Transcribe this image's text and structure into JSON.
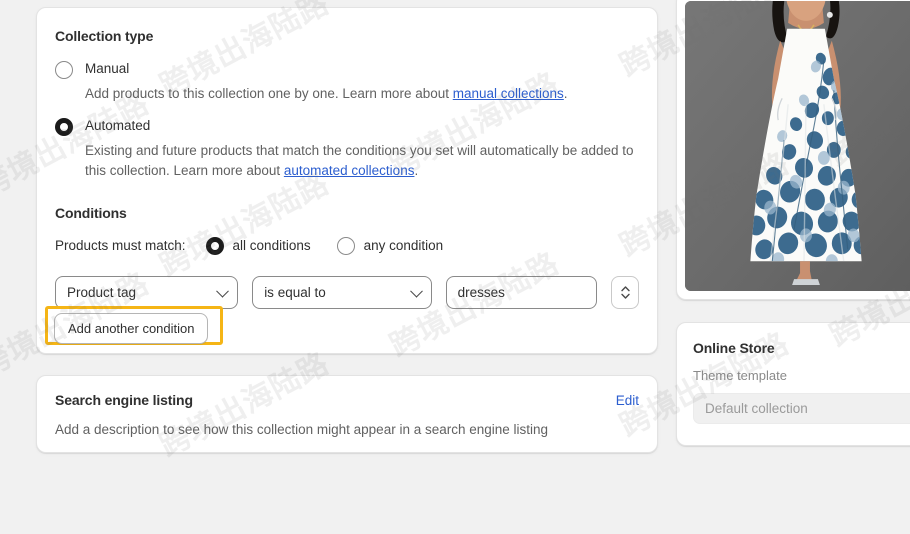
{
  "collection_type": {
    "title": "Collection type",
    "options": [
      {
        "label": "Manual",
        "selected": false,
        "desc_before": "Add products to this collection one by one. Learn more about ",
        "link": "manual collections",
        "desc_after": "."
      },
      {
        "label": "Automated",
        "selected": true,
        "desc_before": "Existing and future products that match the conditions you set will automatically be added to this collection. Learn more about ",
        "link": "automated collections",
        "desc_after": "."
      }
    ]
  },
  "conditions": {
    "title": "Conditions",
    "match_label": "Products must match:",
    "match_options": [
      {
        "label": "all conditions",
        "selected": true
      },
      {
        "label": "any condition",
        "selected": false
      }
    ],
    "row": {
      "field": "Product tag",
      "operator": "is equal to",
      "value": "dresses",
      "value_placeholder": "",
      "reorder_icon": "up-down-chevron-icon"
    },
    "add_button": "Add another condition",
    "highlight_color": "#f5b516"
  },
  "seo": {
    "title": "Search engine listing",
    "edit_label": "Edit",
    "description": "Add a description to see how this collection might appear in a search engine listing"
  },
  "online_store": {
    "title": "Online Store",
    "theme_template_label": "Theme template",
    "theme_template_value": "Default collection"
  },
  "product_image": {
    "alt": "Woman wearing white maxi dress with blue floral print",
    "background_color": "#6d6d6d"
  },
  "watermark": {
    "text": "跨境出海陆路"
  }
}
